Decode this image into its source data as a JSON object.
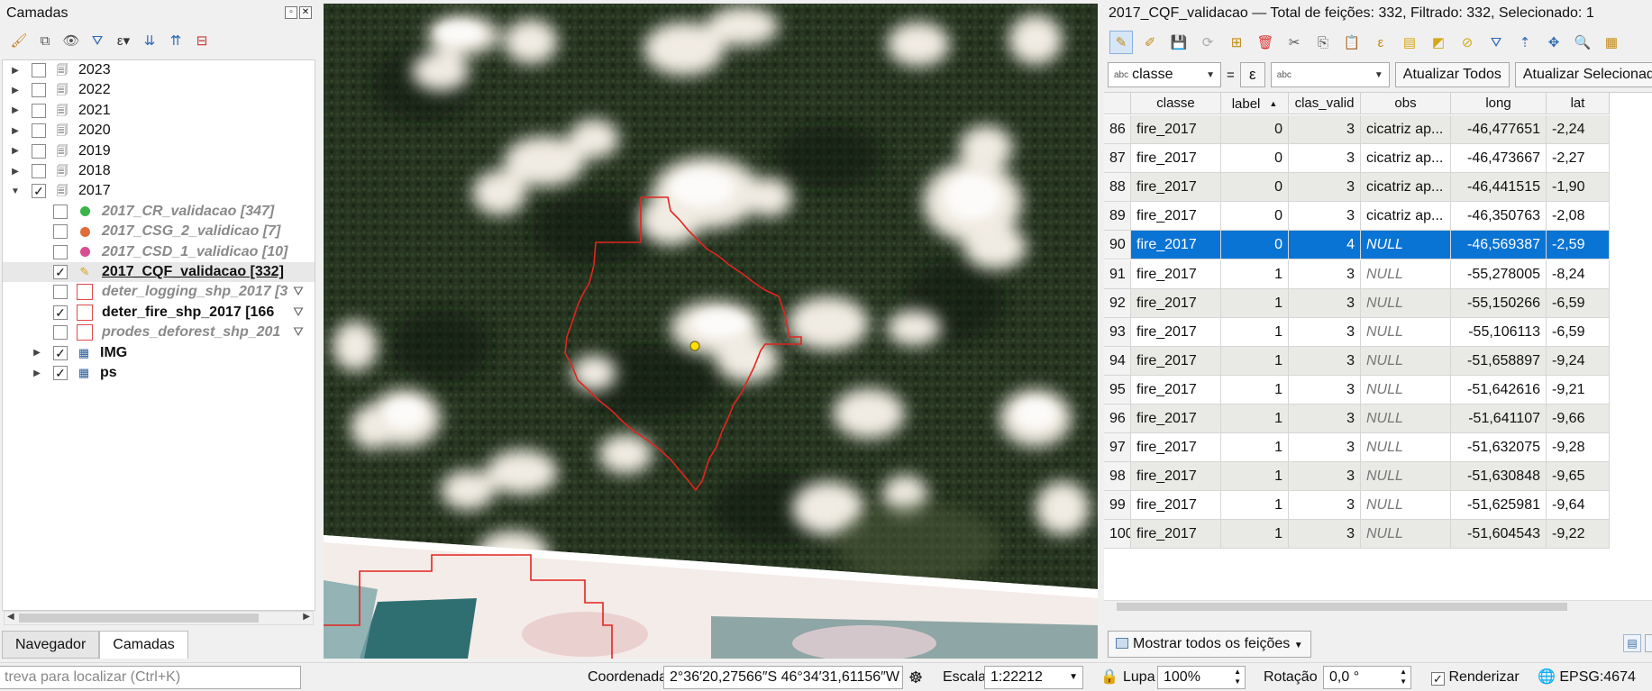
{
  "layers_panel": {
    "title": "Camadas",
    "toolbar_icons": [
      "paint-brush-icon",
      "add-group-icon",
      "eye-icon",
      "filter-icon",
      "expression-filter-icon",
      "expand-all-icon",
      "collapse-all-icon",
      "remove-layer-icon"
    ],
    "groups": [
      {
        "label": "2023",
        "checked": false,
        "expanded": false
      },
      {
        "label": "2022",
        "checked": false,
        "expanded": false
      },
      {
        "label": "2021",
        "checked": false,
        "expanded": false
      },
      {
        "label": "2020",
        "checked": false,
        "expanded": false
      },
      {
        "label": "2019",
        "checked": false,
        "expanded": false
      },
      {
        "label": "2018",
        "checked": false,
        "expanded": false
      },
      {
        "label": "2017",
        "checked": true,
        "expanded": true
      }
    ],
    "layers_2017": [
      {
        "label": "2017_CR_validacao [347]",
        "checked": false,
        "symbol": "dot",
        "color": "#3bb54a"
      },
      {
        "label": "2017_CSG_2_validicao [7]",
        "checked": false,
        "symbol": "dot",
        "color": "#e06c3c"
      },
      {
        "label": "2017_CSD_1_validicao [10]",
        "checked": false,
        "symbol": "dot",
        "color": "#d74f8f"
      },
      {
        "label": "2017_CQF_validacao [332]",
        "checked": true,
        "symbol": "edit",
        "color": "#d9a21b"
      },
      {
        "label": "deter_logging_shp_2017 [3",
        "checked": false,
        "symbol": "square",
        "color": "#e04a4a"
      },
      {
        "label": "deter_fire_shp_2017 [166",
        "checked": true,
        "symbol": "square",
        "color": "#e04a4a"
      },
      {
        "label": "prodes_deforest_shp_201",
        "checked": false,
        "symbol": "square",
        "color": "#e04a4a"
      }
    ],
    "raster_layers": [
      {
        "label": "IMG",
        "checked": true
      },
      {
        "label": "ps",
        "checked": true
      }
    ],
    "tabs": [
      "Navegador",
      "Camadas"
    ]
  },
  "attribute_table": {
    "title": "2017_CQF_validacao — Total de feições: 332, Filtrado: 332, Selecionado: 1",
    "field_select": "classe",
    "equals": "=",
    "expr_symbol": "ε",
    "value_placeholder": "abc",
    "update_all_label": "Atualizar Todos",
    "update_selected_label": "Atualizar Selecionad",
    "columns": [
      "classe",
      "label",
      "clas_valid",
      "obs",
      "long",
      "lat"
    ],
    "sort_indicator": "▲",
    "rows": [
      {
        "n": "86",
        "classe": "fire_2017",
        "label": "0",
        "clas_valid": "3",
        "obs": "cicatriz ap...",
        "long": "-46,477651",
        "lat": "-2,24",
        "selected": false
      },
      {
        "n": "87",
        "classe": "fire_2017",
        "label": "0",
        "clas_valid": "3",
        "obs": "cicatriz ap...",
        "long": "-46,473667",
        "lat": "-2,27",
        "selected": false
      },
      {
        "n": "88",
        "classe": "fire_2017",
        "label": "0",
        "clas_valid": "3",
        "obs": "cicatriz ap...",
        "long": "-46,441515",
        "lat": "-1,90",
        "selected": false
      },
      {
        "n": "89",
        "classe": "fire_2017",
        "label": "0",
        "clas_valid": "3",
        "obs": "cicatriz ap...",
        "long": "-46,350763",
        "lat": "-2,08",
        "selected": false
      },
      {
        "n": "90",
        "classe": "fire_2017",
        "label": "0",
        "clas_valid": "4",
        "obs": "NULL",
        "long": "-46,569387",
        "lat": "-2,59",
        "selected": true
      },
      {
        "n": "91",
        "classe": "fire_2017",
        "label": "1",
        "clas_valid": "3",
        "obs": "NULL",
        "long": "-55,278005",
        "lat": "-8,24",
        "selected": false
      },
      {
        "n": "92",
        "classe": "fire_2017",
        "label": "1",
        "clas_valid": "3",
        "obs": "NULL",
        "long": "-55,150266",
        "lat": "-6,59",
        "selected": false
      },
      {
        "n": "93",
        "classe": "fire_2017",
        "label": "1",
        "clas_valid": "3",
        "obs": "NULL",
        "long": "-55,106113",
        "lat": "-6,59",
        "selected": false
      },
      {
        "n": "94",
        "classe": "fire_2017",
        "label": "1",
        "clas_valid": "3",
        "obs": "NULL",
        "long": "-51,658897",
        "lat": "-9,24",
        "selected": false
      },
      {
        "n": "95",
        "classe": "fire_2017",
        "label": "1",
        "clas_valid": "3",
        "obs": "NULL",
        "long": "-51,642616",
        "lat": "-9,21",
        "selected": false
      },
      {
        "n": "96",
        "classe": "fire_2017",
        "label": "1",
        "clas_valid": "3",
        "obs": "NULL",
        "long": "-51,641107",
        "lat": "-9,66",
        "selected": false
      },
      {
        "n": "97",
        "classe": "fire_2017",
        "label": "1",
        "clas_valid": "3",
        "obs": "NULL",
        "long": "-51,632075",
        "lat": "-9,28",
        "selected": false
      },
      {
        "n": "98",
        "classe": "fire_2017",
        "label": "1",
        "clas_valid": "3",
        "obs": "NULL",
        "long": "-51,630848",
        "lat": "-9,65",
        "selected": false
      },
      {
        "n": "99",
        "classe": "fire_2017",
        "label": "1",
        "clas_valid": "3",
        "obs": "NULL",
        "long": "-51,625981",
        "lat": "-9,64",
        "selected": false
      },
      {
        "n": "100",
        "classe": "fire_2017",
        "label": "1",
        "clas_valid": "3",
        "obs": "NULL",
        "long": "-51,604543",
        "lat": "-9,22",
        "selected": false
      }
    ],
    "show_all_label": "Mostrar todos os feições",
    "selected_color": "#0a74d5"
  },
  "status_bar": {
    "locator_placeholder": "treva para localizar (Ctrl+K)",
    "coord_label": "Coordenada",
    "coord_value": "2°36′20,27566″S  46°34′31,61156″W",
    "scale_label": "Escala",
    "scale_value": "1:22212",
    "magnifier_label": "Lupa",
    "magnifier_value": "100%",
    "rotation_label": "Rotação",
    "rotation_value": "0,0 °",
    "render_label": "Renderizar",
    "crs_label": "EPSG:4674"
  }
}
